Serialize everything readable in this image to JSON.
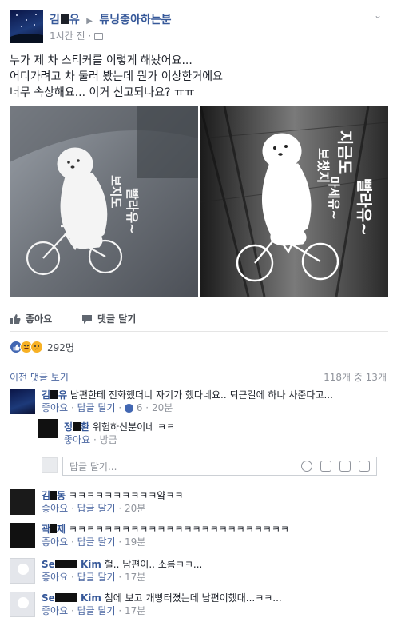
{
  "post": {
    "author": "김",
    "author_suffix": "유",
    "group": "튜닝좋아하는분",
    "time": "1시간 전 ·",
    "text_lines": [
      "누가 제 차 스티커를 이렇게 해놨어요...",
      "어디가려고 차 둘러 봤는데 뭔가 이상한거에요",
      "너무 속상해요... 이거 신고되나요? ㅠㅠ"
    ],
    "photo1_text": [
      "보지도",
      "빨라유~"
    ],
    "photo2_text": [
      "지금도",
      "보챘지",
      "마세유~",
      "빨라유~"
    ]
  },
  "actions": {
    "like": "좋아요",
    "comment": "댓글 달기"
  },
  "reactions": {
    "count": "292명"
  },
  "comments_header": {
    "prev": "이전 댓글 보기",
    "count": "118개 중 13개"
  },
  "comments": [
    {
      "name_a": "김",
      "name_b": "유",
      "text": "남편한테 전화했더니 자기가 했다네요.. 퇴근길에 하나 사준다고...",
      "like": "좋아요",
      "reply": "답글 달기",
      "likes": "6",
      "time": "20분"
    },
    {
      "name_a": "정",
      "name_b": "환",
      "text": "위험하신분이네 ㅋㅋ",
      "like": "좋아요",
      "time": "방금"
    },
    {
      "name_a": "김",
      "name_b": "동",
      "text": "ㅋㅋㅋㅋㅋㅋㅋㅋㅋㅋ얔ㅋㅋ",
      "like": "좋아요",
      "reply": "답글 달기",
      "time": "20분"
    },
    {
      "name_a": "곽",
      "name_b": "제",
      "text": "ㅋㅋㅋㅋㅋㅋㅋㅋㅋㅋㅋㅋㅋㅋㅋㅋㅋㅋㅋㅋㅋㅋㅋㅋㅋ",
      "like": "좋아요",
      "reply": "답글 달기",
      "time": "19분"
    },
    {
      "name_a": "Se",
      "name_b": "Kim",
      "text": "헐.. 남편이.. 소름ㅋㅋ...",
      "like": "좋아요",
      "reply": "답글 달기",
      "time": "17분"
    },
    {
      "name_a": "Se",
      "name_b": "Kim",
      "text": "첨에 보고 개빵터졌는데 남편이했대...ㅋㅋ...",
      "like": "좋아요",
      "reply": "답글 달기",
      "time": "17분"
    }
  ],
  "reply_placeholder": "답글 달기...",
  "meta_sep": " · "
}
